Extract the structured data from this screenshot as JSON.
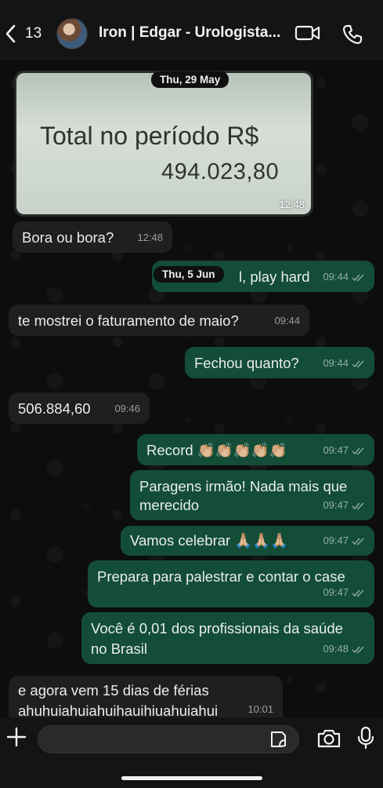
{
  "header": {
    "back_count": "13",
    "title": "Iron | Edgar - Urologista..."
  },
  "chat": {
    "date_1": "Thu, 29 May",
    "image_message": {
      "line1": "Total no período R$",
      "line2": "494.023,80",
      "time": "12:48"
    },
    "date_2": "Thu, 5 Jun",
    "messages": [
      {
        "dir": "in",
        "text": "Bora ou bora?",
        "time": "12:48"
      },
      {
        "dir": "out",
        "text": "l, play hard",
        "time": "09:44"
      },
      {
        "dir": "in",
        "text": "te mostrei o faturamento de maio?",
        "time": "09:44"
      },
      {
        "dir": "out",
        "text": "Fechou quanto?",
        "time": "09:44"
      },
      {
        "dir": "in",
        "text": "506.884,60",
        "time": "09:46"
      },
      {
        "dir": "out",
        "text": "Record 👏🏼👏🏼👏🏼👏🏼👏🏼",
        "time": "09:47"
      },
      {
        "dir": "out",
        "line1": "Paragens irmão! Nada mais que",
        "line2": "merecido",
        "time": "09:47"
      },
      {
        "dir": "out",
        "text": "Vamos celebrar 🙏🏼🙏🏼🙏🏼",
        "time": "09:47"
      },
      {
        "dir": "out",
        "text": "Prepara para palestrar e contar o case",
        "time": "09:47"
      },
      {
        "dir": "out",
        "line1": "Você é 0,01 dos profissionais da saúde",
        "line2": "no Brasil",
        "time": "09:48"
      },
      {
        "dir": "in",
        "line1": "e agora vem 15 dias de férias",
        "line2": "ahuhuiahuiahuihauihiuahuiahui",
        "time": "10:01"
      }
    ]
  },
  "composer": {
    "placeholder": ""
  },
  "colors": {
    "outgoing_bubble": "#134d37",
    "incoming_bubble": "#1f1f1f",
    "read_ticks": "#8fa8a0"
  },
  "icons": [
    "chevron-left-icon",
    "video-call-icon",
    "phone-icon",
    "plus-icon",
    "sticker-icon",
    "camera-icon",
    "microphone-icon",
    "double-check-icon"
  ]
}
